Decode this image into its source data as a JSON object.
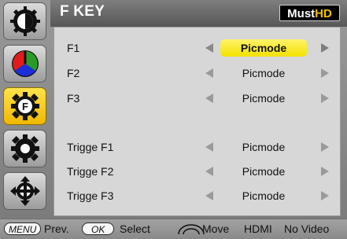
{
  "header": {
    "title": "F KEY",
    "brand_part1": "Must",
    "brand_part2": "HD"
  },
  "sidebar": {
    "items": [
      {
        "name": "contrast-icon"
      },
      {
        "name": "color-icon"
      },
      {
        "name": "fkey-gear-icon"
      },
      {
        "name": "settings-gear-icon"
      },
      {
        "name": "move-icon"
      }
    ],
    "active_index": 2
  },
  "menu": {
    "rows": [
      {
        "label": "F1",
        "value": "Picmode",
        "selected": true
      },
      {
        "label": "F2",
        "value": "Picmode"
      },
      {
        "label": "F3",
        "value": "Picmode"
      },
      {
        "label": "Trigge F1",
        "value": "Picmode"
      },
      {
        "label": "Trigge F2",
        "value": "Picmode"
      },
      {
        "label": "Trigge F3",
        "value": "Picmode"
      }
    ]
  },
  "footer": {
    "menu_key": "MENU",
    "prev": "Prev.",
    "ok_key": "OK",
    "select": "Select",
    "move": "Move",
    "input": "HDMI",
    "status": "No Video"
  },
  "colors": {
    "highlight": "#f7ea2a",
    "active_tab": "#f5c518",
    "brand_accent": "#f2c200"
  }
}
